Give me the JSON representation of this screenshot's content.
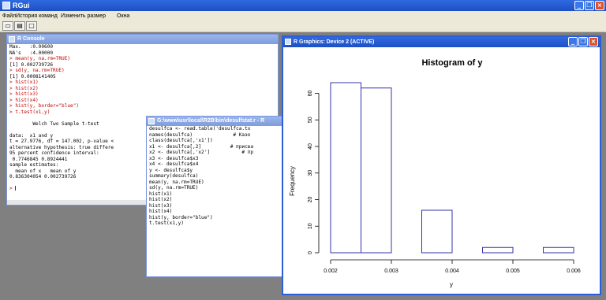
{
  "app": {
    "title": "RGui",
    "menu": [
      "Файл",
      "История команд",
      "Изменить размер",
      "Окна"
    ]
  },
  "console": {
    "title": "R Console",
    "lines": [
      {
        "t": "Max.   :0.00600",
        "k": "c"
      },
      {
        "t": "NA's   :4.00000",
        "k": "c"
      },
      {
        "t": "> mean(y, na.rm=TRUE)",
        "k": "r"
      },
      {
        "t": "[1] 0.002739726",
        "k": "c"
      },
      {
        "t": "> sd(y, na.rm=TRUE)",
        "k": "r"
      },
      {
        "t": "[1] 0.0008141405",
        "k": "c"
      },
      {
        "t": "> hist(x1)",
        "k": "r"
      },
      {
        "t": "> hist(x2)",
        "k": "r"
      },
      {
        "t": "> hist(x3)",
        "k": "r"
      },
      {
        "t": "> hist(x4)",
        "k": "r"
      },
      {
        "t": "> hist(y, border=\"blue\")",
        "k": "r"
      },
      {
        "t": "> t.test(x1,y)",
        "k": "r"
      },
      {
        "t": "",
        "k": "c"
      },
      {
        "t": "        Welch Two Sample t-test",
        "k": "c"
      },
      {
        "t": "",
        "k": "c"
      },
      {
        "t": "data:  x1 and y",
        "k": "c"
      },
      {
        "t": "t = 27.9776, df = 147.002, p-value <",
        "k": "c"
      },
      {
        "t": "alternative hypothesis: true differe",
        "k": "c"
      },
      {
        "t": "95 percent confidence interval:",
        "k": "c"
      },
      {
        "t": " 0.7746845 0.8924441",
        "k": "c"
      },
      {
        "t": "sample estimates:",
        "k": "c"
      },
      {
        "t": "  mean of x   mean of y",
        "k": "c"
      },
      {
        "t": "0.836304054 0.002739726",
        "k": "c"
      },
      {
        "t": "",
        "k": "c"
      },
      {
        "t": "> ",
        "k": "r"
      }
    ]
  },
  "script": {
    "title": "G:\\www\\usr\\local\\R2B\\bin\\desulfstat.r - R",
    "lines": [
      "desulfca <- read.table('desulfca.tx",
      "names(desulfca)              # Каэо",
      "class(desulfca[,'x1'])",
      "x1 <- desulfca[,2]          # присва",
      "x2 <- desulfca[,'x2']           # пр",
      "x3 <- desulfca$x3",
      "x4 <- desulfca$x4",
      "y <- desulfca$y",
      "summary(desulfca)",
      "mean(y, na.rm=TRUE)",
      "sd(y, na.rm=TRUE)",
      "hist(x1)",
      "hist(x2)",
      "hist(x3)",
      "hist(x4)",
      "hist(y, border=\"blue\")",
      "t.test(x1,y)"
    ]
  },
  "graphics": {
    "title": "R Graphics: Device 2 (ACTIVE)"
  },
  "chart_data": {
    "type": "bar",
    "title": "Histogram of y",
    "xlabel": "y",
    "ylabel": "Frequency",
    "bins": [
      {
        "start": 0.002,
        "end": 0.0025,
        "count": 64
      },
      {
        "start": 0.0025,
        "end": 0.003,
        "count": 62
      },
      {
        "start": 0.003,
        "end": 0.0035,
        "count": 0
      },
      {
        "start": 0.0035,
        "end": 0.004,
        "count": 16
      },
      {
        "start": 0.004,
        "end": 0.0045,
        "count": 0
      },
      {
        "start": 0.0045,
        "end": 0.005,
        "count": 2
      },
      {
        "start": 0.005,
        "end": 0.0055,
        "count": 0
      },
      {
        "start": 0.0055,
        "end": 0.006,
        "count": 2
      }
    ],
    "xticks": [
      "0.002",
      "0.003",
      "0.004",
      "0.005",
      "0.006"
    ],
    "yticks": [
      "0",
      "10",
      "20",
      "30",
      "40",
      "50",
      "60"
    ],
    "xlim": [
      0.002,
      0.006
    ],
    "ylim": [
      0,
      64
    ],
    "bar_color": "#3333aa"
  }
}
